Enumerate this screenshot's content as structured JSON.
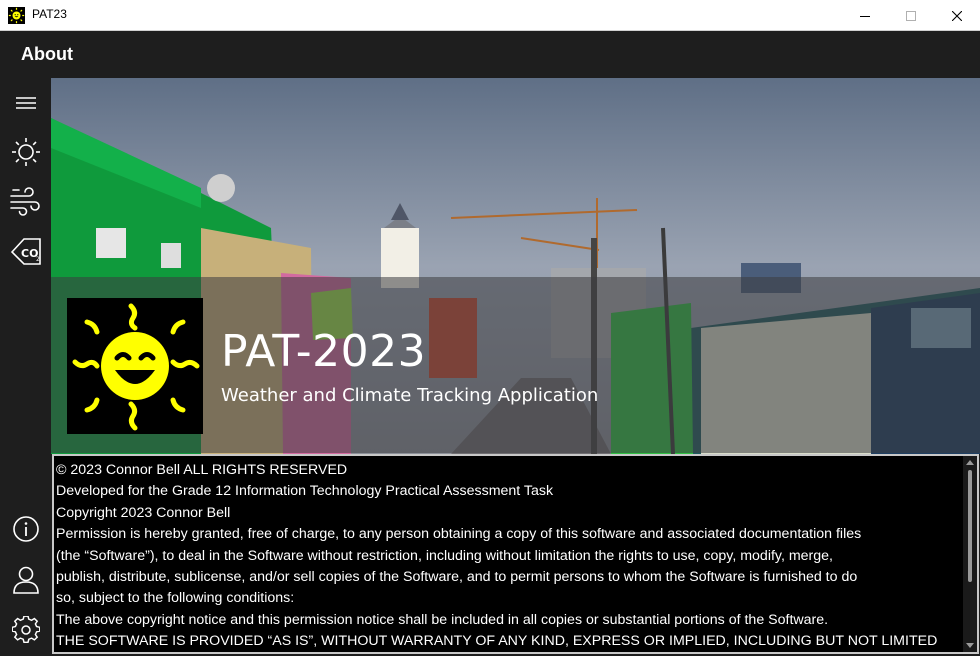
{
  "window": {
    "title": "PAT23",
    "app_icon": "sun-icon",
    "controls": [
      "minimize-icon",
      "maximize-icon",
      "close-icon"
    ]
  },
  "header": {
    "title": "About"
  },
  "sidebar": {
    "top_items": [
      {
        "icon": "hamburger-menu-icon"
      },
      {
        "icon": "sun-icon"
      },
      {
        "icon": "wind-icon"
      },
      {
        "icon": "co2-icon"
      }
    ],
    "bottom_items": [
      {
        "icon": "info-icon"
      },
      {
        "icon": "user-icon"
      },
      {
        "icon": "settings-gear-icon"
      }
    ]
  },
  "hero": {
    "title": "PAT-2023",
    "subtitle": "Weather and Climate Tracking Application",
    "logo_icon": "smiling-sun-icon"
  },
  "license": {
    "lines": [
      "© 2023 Connor Bell ALL RIGHTS RESERVED",
      "Developed for the Grade 12 Information Technology Practical Assessment Task",
      "Copyright 2023 Connor Bell",
      "Permission is hereby granted, free of charge, to any person obtaining a copy of this software and associated documentation files",
      "(the “Software”), to deal in the Software without restriction, including without limitation the rights to use, copy, modify, merge,",
      "publish, distribute, sublicense, and/or sell copies of the Software, and to permit persons to whom the Software is furnished to do",
      "so, subject to the following conditions:",
      "The above copyright notice and this permission notice shall be included in all copies or substantial portions of the Software.",
      "THE SOFTWARE IS PROVIDED “AS IS”, WITHOUT WARRANTY OF ANY KIND, EXPRESS OR IMPLIED, INCLUDING BUT NOT LIMITED"
    ]
  },
  "colors": {
    "background": "#1e1e1e",
    "titlebar": "#ffffff",
    "logo_sun": "#ffff00",
    "license_bg": "#000000",
    "text": "#ffffff"
  }
}
